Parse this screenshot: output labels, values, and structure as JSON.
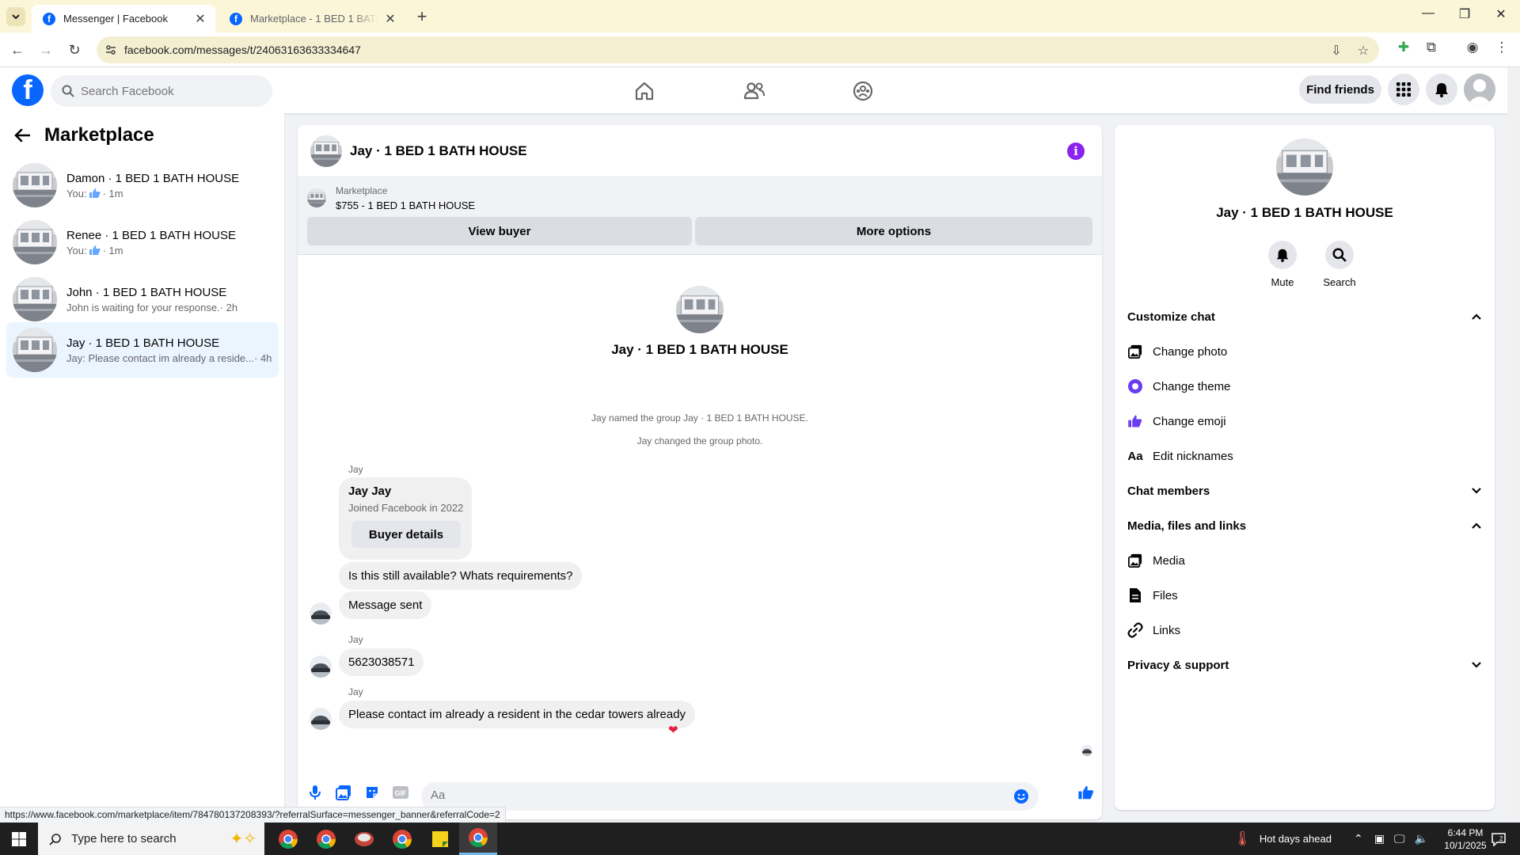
{
  "browser": {
    "tabs": [
      {
        "title": "Messenger | Facebook",
        "active": true
      },
      {
        "title": "Marketplace - 1 BED 1 BATH HOUSE",
        "active": false
      }
    ],
    "url": "facebook.com/messages/t/24063163633334647",
    "status_url": "https://www.facebook.com/marketplace/item/784780137208393/?referralSurface=messenger_banner&referralCode=2"
  },
  "fbnav": {
    "search_placeholder": "Search Facebook",
    "find_friends": "Find friends"
  },
  "sidebar": {
    "title": "Marketplace",
    "conversations": [
      {
        "name": "Damon · 1 BED 1 BATH HOUSE",
        "prefix": "You:",
        "icon": "thumbs-up-icon",
        "snippet": "",
        "time": "· 1m"
      },
      {
        "name": "Renee · 1 BED 1 BATH HOUSE",
        "prefix": "You:",
        "icon": "thumbs-up-icon",
        "snippet": "",
        "time": "· 1m"
      },
      {
        "name": "John · 1 BED 1 BATH HOUSE",
        "prefix": "",
        "snippet": "John is waiting for your response.",
        "time": " · 2h"
      },
      {
        "name": "Jay · 1 BED 1 BATH HOUSE",
        "prefix": "",
        "snippet": "Jay: Please contact im already a reside...",
        "time": " · 4h",
        "selected": true
      }
    ]
  },
  "chat": {
    "title": "Jay · 1 BED 1 BATH HOUSE",
    "banner": {
      "label": "Marketplace",
      "listing": "$755 - 1 BED 1 BATH HOUSE",
      "view_buyer": "View buyer",
      "more_options": "More options"
    },
    "profile_name": "Jay · 1 BED 1 BATH HOUSE",
    "system_messages": [
      "Jay named the group Jay · 1 BED 1 BATH HOUSE.",
      "Jay changed the group photo."
    ],
    "sender": "Jay",
    "buyer_card": {
      "name": "Jay Jay",
      "joined": "Joined Facebook in 2022",
      "button": "Buyer details"
    },
    "messages": [
      "Is this still available? Whats requirements?",
      "Message sent",
      "5623038571",
      "Please contact im already a resident in the cedar towers already"
    ],
    "reaction": "❤",
    "composer_placeholder": "Aa"
  },
  "info_panel": {
    "name": "Jay · 1 BED 1 BATH HOUSE",
    "actions": [
      {
        "label": "Mute",
        "icon": "bell-icon"
      },
      {
        "label": "Search",
        "icon": "search-icon"
      }
    ],
    "sections": {
      "customize": "Customize chat",
      "members": "Chat members",
      "media": "Media, files and links",
      "privacy": "Privacy & support"
    },
    "customize_items": [
      {
        "label": "Change photo",
        "icon": "photo-icon"
      },
      {
        "label": "Change theme",
        "icon": "theme-icon"
      },
      {
        "label": "Change emoji",
        "icon": "thumbs-up-icon"
      },
      {
        "label": "Edit nicknames",
        "icon": "Aa"
      }
    ],
    "media_items": [
      {
        "label": "Media",
        "icon": "photo-icon"
      },
      {
        "label": "Files",
        "icon": "file-icon"
      },
      {
        "label": "Links",
        "icon": "link-icon"
      }
    ]
  },
  "taskbar": {
    "search_placeholder": "Type here to search",
    "weather": "Hot days ahead",
    "time": "6:44 PM",
    "date": "10/1/2025"
  },
  "colors": {
    "brand": "#0866ff",
    "selected_conv": "#ebf5ff",
    "info_accent": "#8a22f0",
    "heart": "#e41e3f"
  }
}
